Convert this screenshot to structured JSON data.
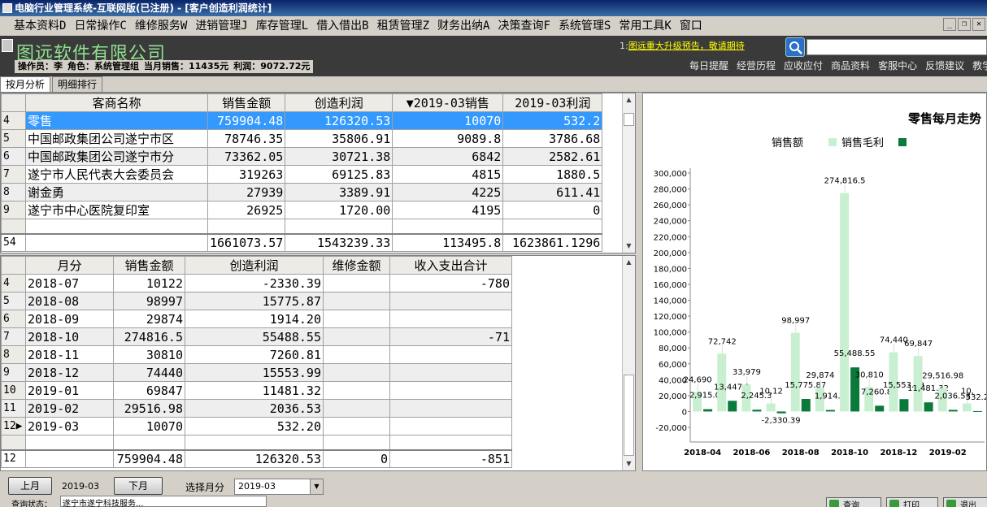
{
  "window": {
    "title": "电脑行业管理系统-互联网版(已注册) - [客户创造利润统计]"
  },
  "menu": [
    "基本资料D",
    "日常操作C",
    "维修服务W",
    "进销管理J",
    "库存管理L",
    "借入借出B",
    "租赁管理Z",
    "财务出纳A",
    "决策查询F",
    "系统管理S",
    "常用工具K",
    "窗口"
  ],
  "brand": {
    "company": "图远软件有限公司",
    "operator_label": "操作员：",
    "operator_value": "李",
    "role_label": "角色：",
    "role_value": "系统管理组",
    "sales_label": "当月销售：",
    "sales_value": "11435元",
    "profit_label": "利润：",
    "profit_value": "9072.72元",
    "notice_num": "1:",
    "notice_text": "图远重大升级预告，敬请期待",
    "quicklinks": [
      "每日提醒",
      "经营历程",
      "应收应付",
      "商品资料",
      "客服中心",
      "反馈建议",
      "教学"
    ]
  },
  "tabs": [
    "按月分析",
    "明细排行"
  ],
  "top_table": {
    "headers": [
      "客商名称",
      "销售金额",
      "创造利润",
      "▼2019-03销售",
      "2019-03利润"
    ],
    "rows": [
      {
        "idx": "4",
        "name": "零售",
        "sales": "759904.48",
        "profit": "126320.53",
        "m_sales": "10070",
        "m_profit": "532.2"
      },
      {
        "idx": "5",
        "name": "中国邮政集团公司遂宁市区",
        "sales": "78746.35",
        "profit": "35806.91",
        "m_sales": "9089.8",
        "m_profit": "3786.68"
      },
      {
        "idx": "6",
        "name": "中国邮政集团公司遂宁市分",
        "sales": "73362.05",
        "profit": "30721.38",
        "m_sales": "6842",
        "m_profit": "2582.61"
      },
      {
        "idx": "7",
        "name": "遂宁市人民代表大会委员会",
        "sales": "319263",
        "profit": "69125.83",
        "m_sales": "4815",
        "m_profit": "1880.5"
      },
      {
        "idx": "8",
        "name": "谢金勇",
        "sales": "27939",
        "profit": "3389.91",
        "m_sales": "4225",
        "m_profit": "611.41"
      },
      {
        "idx": "9",
        "name": "遂宁市中心医院复印室",
        "sales": "26925",
        "profit": "1720.00",
        "m_sales": "4195",
        "m_profit": "0"
      }
    ],
    "total": {
      "idx": "54",
      "sales": "1661073.57",
      "profit": "1543239.33",
      "m_sales": "113495.8",
      "m_profit": "1623861.1296"
    }
  },
  "bottom_table": {
    "headers": [
      "月分",
      "销售金额",
      "创造利润",
      "维修金额",
      "收入支出合计"
    ],
    "rows": [
      {
        "idx": "4",
        "month": "2018-07",
        "sales": "10122",
        "profit": "-2330.39",
        "repair": "",
        "io": "-780"
      },
      {
        "idx": "5",
        "month": "2018-08",
        "sales": "98997",
        "profit": "15775.87",
        "repair": "",
        "io": ""
      },
      {
        "idx": "6",
        "month": "2018-09",
        "sales": "29874",
        "profit": "1914.20",
        "repair": "",
        "io": ""
      },
      {
        "idx": "7",
        "month": "2018-10",
        "sales": "274816.5",
        "profit": "55488.55",
        "repair": "",
        "io": "-71"
      },
      {
        "idx": "8",
        "month": "2018-11",
        "sales": "30810",
        "profit": "7260.81",
        "repair": "",
        "io": ""
      },
      {
        "idx": "9",
        "month": "2018-12",
        "sales": "74440",
        "profit": "15553.99",
        "repair": "",
        "io": ""
      },
      {
        "idx": "10",
        "month": "2019-01",
        "sales": "69847",
        "profit": "11481.32",
        "repair": "",
        "io": ""
      },
      {
        "idx": "11",
        "month": "2019-02",
        "sales": "29516.98",
        "profit": "2036.53",
        "repair": "",
        "io": ""
      },
      {
        "idx": "12▶",
        "month": "2019-03",
        "sales": "10070",
        "profit": "532.20",
        "repair": "",
        "io": ""
      }
    ],
    "total": {
      "idx": "12",
      "sales": "759904.48",
      "profit": "126320.53",
      "repair": "0",
      "io": "-851"
    }
  },
  "chart_data": {
    "type": "bar",
    "title": "零售每月走势",
    "legend": [
      "销售额",
      "销售毛利"
    ],
    "legend_placement": "top",
    "colors": {
      "sales": "#c8f0d0",
      "profit": "#0a7a3a"
    },
    "ylim": [
      -20000,
      300000
    ],
    "yticks": [
      "300,000",
      "280,000",
      "260,000",
      "240,000",
      "220,000",
      "200,000",
      "180,000",
      "160,000",
      "140,000",
      "120,000",
      "100,000",
      "80,000",
      "60,000",
      "40,000",
      "20,000",
      "0",
      "-20,000"
    ],
    "categories": [
      "2018-04",
      "2018-05",
      "2018-06",
      "2018-07",
      "2018-08",
      "2018-09",
      "2018-10",
      "2018-11",
      "2018-12",
      "2019-01",
      "2019-02",
      "2019-03"
    ],
    "xtick_labels": [
      "2018-04",
      "",
      "2018-06",
      "",
      "2018-08",
      "",
      "2018-10",
      "",
      "2018-12",
      "",
      "2019-02",
      ""
    ],
    "series": [
      {
        "name": "销售额",
        "values": [
          24690,
          72742,
          33979,
          10122,
          98997,
          29874,
          274816.5,
          30810,
          74440,
          69847,
          29516.98,
          10070
        ]
      },
      {
        "name": "销售毛利",
        "values": [
          2915.05,
          13447.1,
          2245.3,
          -2330.39,
          15775.87,
          1914.2,
          55488.55,
          7260.81,
          15553.99,
          11481.32,
          2036.53,
          532.2
        ]
      }
    ],
    "sales_labels": [
      "24,690",
      "72,742",
      "33,979",
      "10,12",
      "98,997",
      "29,874",
      "274,816.5",
      "30,810",
      "74,440",
      "69,847",
      "29,516.98",
      "10,"
    ],
    "profit_labels": [
      "2,915.05",
      "13,447.1",
      "2,245.3",
      "-2,330.39",
      "15,775.87",
      "1,914.2",
      "55,488.55",
      "7,260.81",
      "15,553.99",
      "11,481.32",
      "2,036.53",
      "532.2"
    ]
  },
  "footer": {
    "prev_label": "上月",
    "current_month": "2019-03",
    "next_label": "下月",
    "select_label": "选择月分",
    "select_value": "2019-03",
    "status_left": "查询状态：",
    "status_value": "遂宁市遂宁科技服务...",
    "btn_query": "查询",
    "btn_print": "打印",
    "btn_exit": "退出"
  }
}
